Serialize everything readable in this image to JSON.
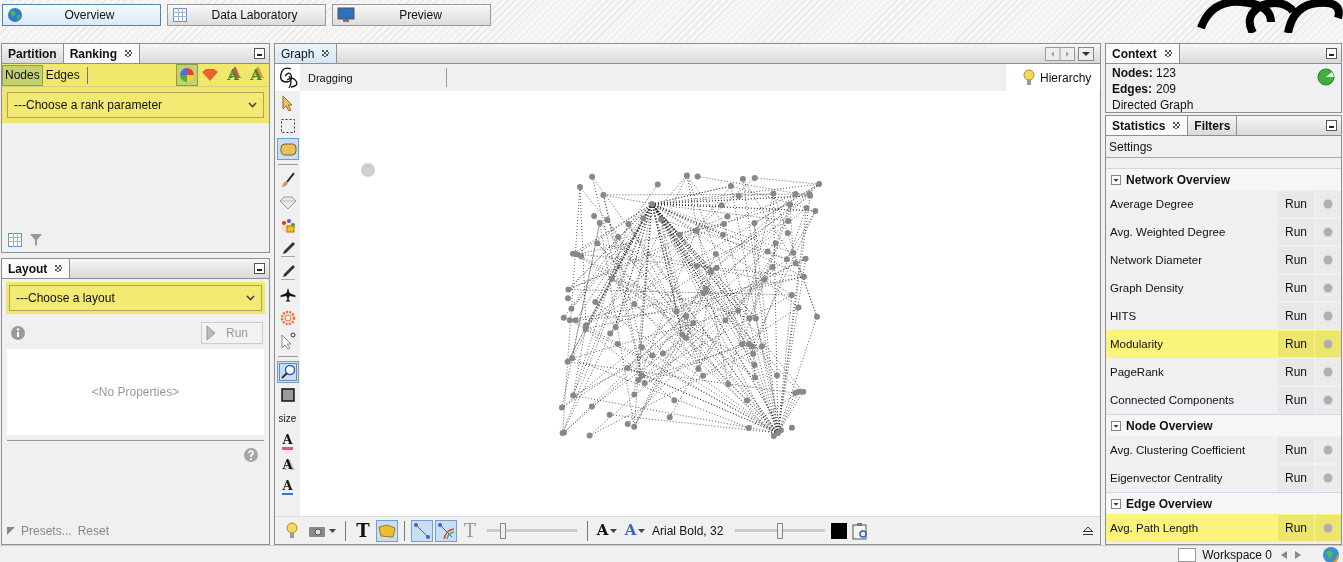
{
  "perspectives": [
    {
      "label": "Overview",
      "selected": true
    },
    {
      "label": "Data Laboratory",
      "selected": false
    },
    {
      "label": "Preview",
      "selected": false
    }
  ],
  "ranking_panel": {
    "tabs": [
      {
        "label": "Partition",
        "selected": false
      },
      {
        "label": "Ranking",
        "selected": true
      }
    ],
    "element_tabs": [
      {
        "label": "Nodes",
        "selected": true
      },
      {
        "label": "Edges",
        "selected": false
      }
    ],
    "transformers": [
      {
        "kind": "color",
        "selected": true
      },
      {
        "kind": "size",
        "selected": false
      },
      {
        "kind": "label-color",
        "glyph": "A",
        "selected": false
      },
      {
        "kind": "label-size",
        "glyph": "A",
        "selected": false
      }
    ],
    "dropdown": "---Choose a rank parameter"
  },
  "layout_panel": {
    "tabs": [
      {
        "label": "Layout",
        "selected": true
      }
    ],
    "dropdown": "---Choose a layout",
    "run_button": {
      "label": "Run",
      "disabled": true
    },
    "properties_placeholder": "<No Properties>",
    "presets": "Presets...",
    "reset": "Reset"
  },
  "graph": {
    "tabs": [
      {
        "label": "Graph",
        "selected": true
      }
    ],
    "mode": "Dragging",
    "hierarchy": "Hierarchy",
    "tools": [
      {
        "kind": "pointer",
        "selected": false
      },
      {
        "kind": "rect-select",
        "selected": false
      },
      {
        "kind": "hand",
        "selected": true
      },
      {
        "kind": "separator"
      },
      {
        "kind": "brush",
        "selected": false
      },
      {
        "kind": "gem",
        "selected": false
      },
      {
        "kind": "palette",
        "selected": false
      },
      {
        "kind": "pencil",
        "selected": false
      },
      {
        "kind": "pencil",
        "selected": false
      },
      {
        "kind": "airplane",
        "selected": false
      },
      {
        "kind": "sun",
        "selected": false
      },
      {
        "kind": "help-pointer",
        "selected": false
      },
      {
        "kind": "separator"
      },
      {
        "kind": "zoom",
        "selected": true
      },
      {
        "kind": "square",
        "selected": false
      },
      {
        "kind": "text",
        "label": "size",
        "selected": false
      },
      {
        "kind": "glyph-underline",
        "glyph": "A",
        "selected": false
      },
      {
        "kind": "glyph-shadow",
        "glyph": "A",
        "selected": false
      },
      {
        "kind": "glyph-arrow",
        "glyph": "A",
        "selected": false
      }
    ],
    "bottom_tools": [
      {
        "kind": "bulb",
        "selected": false
      },
      {
        "kind": "camera",
        "selected": false
      },
      {
        "kind": "separator"
      },
      {
        "kind": "glyph-bold",
        "glyph": "T",
        "selected": false,
        "disabled": false
      },
      {
        "kind": "label-shape",
        "selected": true
      },
      {
        "kind": "separator"
      },
      {
        "kind": "edge-line",
        "selected": true
      },
      {
        "kind": "edge-color",
        "selected": true
      },
      {
        "kind": "glyph-bold",
        "glyph": "T",
        "selected": false,
        "disabled": true
      },
      {
        "kind": "slider",
        "level": 0.18
      },
      {
        "kind": "separator"
      },
      {
        "kind": "glyph-menu",
        "glyph": "A",
        "selected": false,
        "disabled": false
      },
      {
        "kind": "glyph-blue-menu",
        "glyph": "A",
        "selected": false,
        "disabled": false
      },
      {
        "kind": "label",
        "text": "Arial Bold, 32"
      },
      {
        "kind": "slider",
        "level": 0.5
      },
      {
        "kind": "swatch",
        "color": "#000000"
      },
      {
        "kind": "clipboard",
        "selected": false
      }
    ]
  },
  "context": {
    "tabs": [
      {
        "label": "Context",
        "selected": true
      }
    ],
    "rows": [
      {
        "label": "Nodes:",
        "value": "123"
      },
      {
        "label": "Edges:",
        "value": "209"
      }
    ],
    "graph_type": "Directed Graph"
  },
  "statistics": {
    "tabs": [
      {
        "label": "Statistics",
        "selected": true
      },
      {
        "label": "Filters",
        "selected": false
      }
    ],
    "settings": "Settings",
    "groups": [
      {
        "title": "Network Overview",
        "expanded": true,
        "items": [
          {
            "name": "Average Degree",
            "run": "Run",
            "highlighted": false
          },
          {
            "name": "Avg. Weighted Degree",
            "run": "Run",
            "highlighted": false
          },
          {
            "name": "Network Diameter",
            "run": "Run",
            "highlighted": false
          },
          {
            "name": "Graph Density",
            "run": "Run",
            "highlighted": false
          },
          {
            "name": "HITS",
            "run": "Run",
            "highlighted": false
          },
          {
            "name": "Modularity",
            "run": "Run",
            "highlighted": true
          },
          {
            "name": "PageRank",
            "run": "Run",
            "highlighted": false
          },
          {
            "name": "Connected Components",
            "run": "Run",
            "highlighted": false
          }
        ]
      },
      {
        "title": "Node Overview",
        "expanded": true,
        "items": [
          {
            "name": "Avg. Clustering Coefficient",
            "run": "Run",
            "highlighted": false
          },
          {
            "name": "Eigenvector Centrality",
            "run": "Run",
            "highlighted": false
          }
        ]
      },
      {
        "title": "Edge Overview",
        "expanded": true,
        "items": [
          {
            "name": "Avg. Path Length",
            "run": "Run",
            "highlighted": true
          }
        ]
      }
    ]
  },
  "status_bar": {
    "workspace": "Workspace 0"
  }
}
